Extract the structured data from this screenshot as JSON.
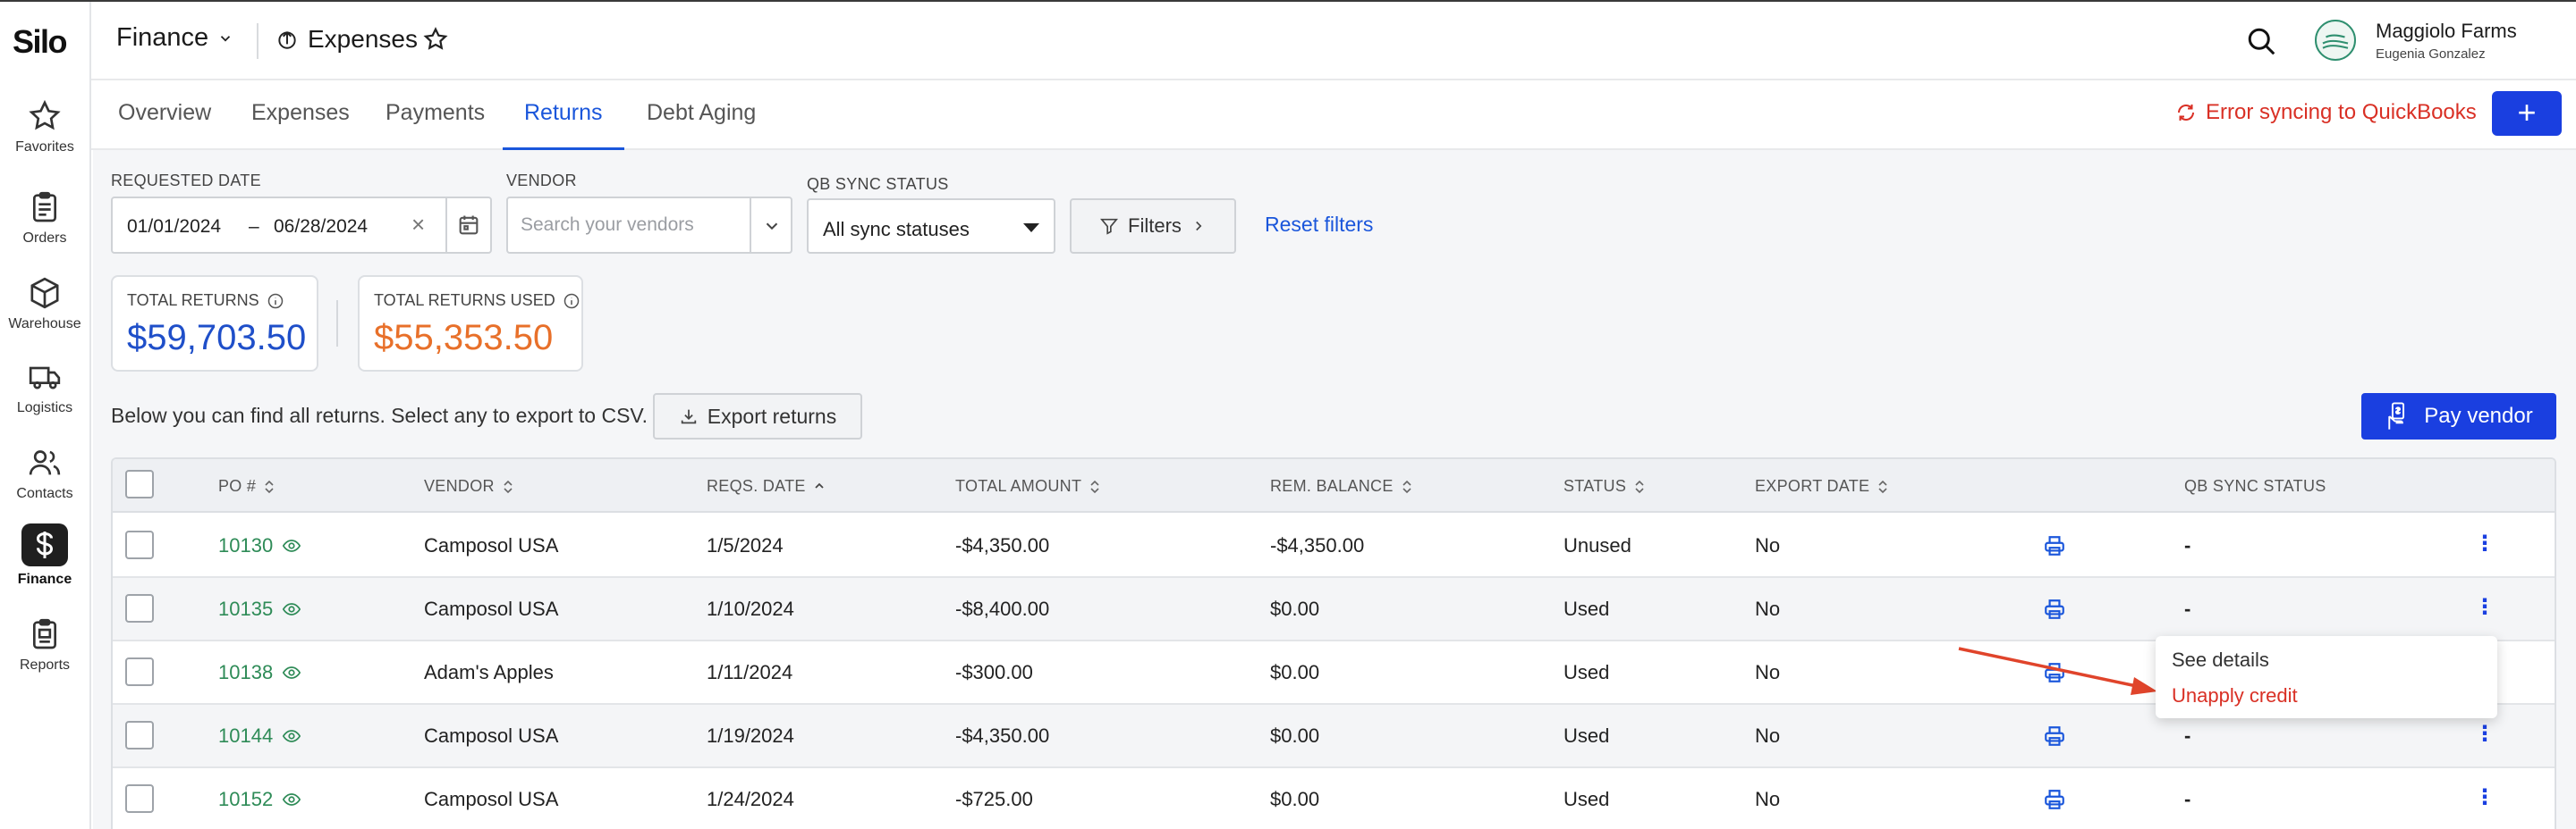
{
  "app": {
    "logo": "Silo"
  },
  "sidebar": {
    "items": [
      {
        "label": "Favorites",
        "icon": "star-icon"
      },
      {
        "label": "Orders",
        "icon": "clipboard-icon"
      },
      {
        "label": "Warehouse",
        "icon": "box-icon"
      },
      {
        "label": "Logistics",
        "icon": "truck-icon"
      },
      {
        "label": "Contacts",
        "icon": "users-icon"
      },
      {
        "label": "Finance",
        "icon": "dollar-icon",
        "active": true
      },
      {
        "label": "Reports",
        "icon": "report-icon"
      }
    ]
  },
  "header": {
    "section": "Finance",
    "page": "Expenses",
    "user_name": "Maggiolo Farms",
    "user_sub": "Eugenia Gonzalez"
  },
  "tabs": [
    {
      "label": "Overview"
    },
    {
      "label": "Expenses"
    },
    {
      "label": "Payments"
    },
    {
      "label": "Returns",
      "active": true
    },
    {
      "label": "Debt Aging"
    }
  ],
  "sync_error": "Error syncing to QuickBooks",
  "plus_label": "+",
  "filters": {
    "requested_date_label": "REQUESTED DATE",
    "date_from": "01/01/2024",
    "date_sep": "–",
    "date_to": "06/28/2024",
    "clear": "×",
    "vendor_label": "VENDOR",
    "vendor_placeholder": "Search your vendors",
    "qb_label": "QB SYNC STATUS",
    "qb_value": "All sync statuses",
    "filters_btn": "Filters",
    "reset": "Reset filters"
  },
  "summary": {
    "total_returns_label": "TOTAL RETURNS",
    "total_returns_value": "$59,703.50",
    "total_used_label": "TOTAL RETURNS USED",
    "total_used_value": "$55,353.50",
    "returns_color": "#1f4fc9",
    "used_color": "#e8702a"
  },
  "info_text": "Below you can find all returns. Select any to export to CSV.",
  "export_btn": "Export returns",
  "pay_btn": "Pay vendor",
  "table": {
    "headers": [
      "PO #",
      "VENDOR",
      "REQS. DATE",
      "TOTAL AMOUNT",
      "REM. BALANCE",
      "STATUS",
      "EXPORT DATE",
      "QB SYNC STATUS"
    ],
    "rows": [
      {
        "po": "10130",
        "vendor": "Camposol USA",
        "date": "1/5/2024",
        "total": "-$4,350.00",
        "balance": "-$4,350.00",
        "status": "Unused",
        "export": "No",
        "qb": "-"
      },
      {
        "po": "10135",
        "vendor": "Camposol USA",
        "date": "1/10/2024",
        "total": "-$8,400.00",
        "balance": "$0.00",
        "status": "Used",
        "export": "No",
        "qb": "-"
      },
      {
        "po": "10138",
        "vendor": "Adam's Apples",
        "date": "1/11/2024",
        "total": "-$300.00",
        "balance": "$0.00",
        "status": "Used",
        "export": "No",
        "qb": ""
      },
      {
        "po": "10144",
        "vendor": "Camposol USA",
        "date": "1/19/2024",
        "total": "-$4,350.00",
        "balance": "$0.00",
        "status": "Used",
        "export": "No",
        "qb": "-"
      },
      {
        "po": "10152",
        "vendor": "Camposol USA",
        "date": "1/24/2024",
        "total": "-$725.00",
        "balance": "$0.00",
        "status": "Used",
        "export": "No",
        "qb": "-"
      }
    ]
  },
  "menu": {
    "see_details": "See details",
    "unapply_credit": "Unapply credit"
  }
}
